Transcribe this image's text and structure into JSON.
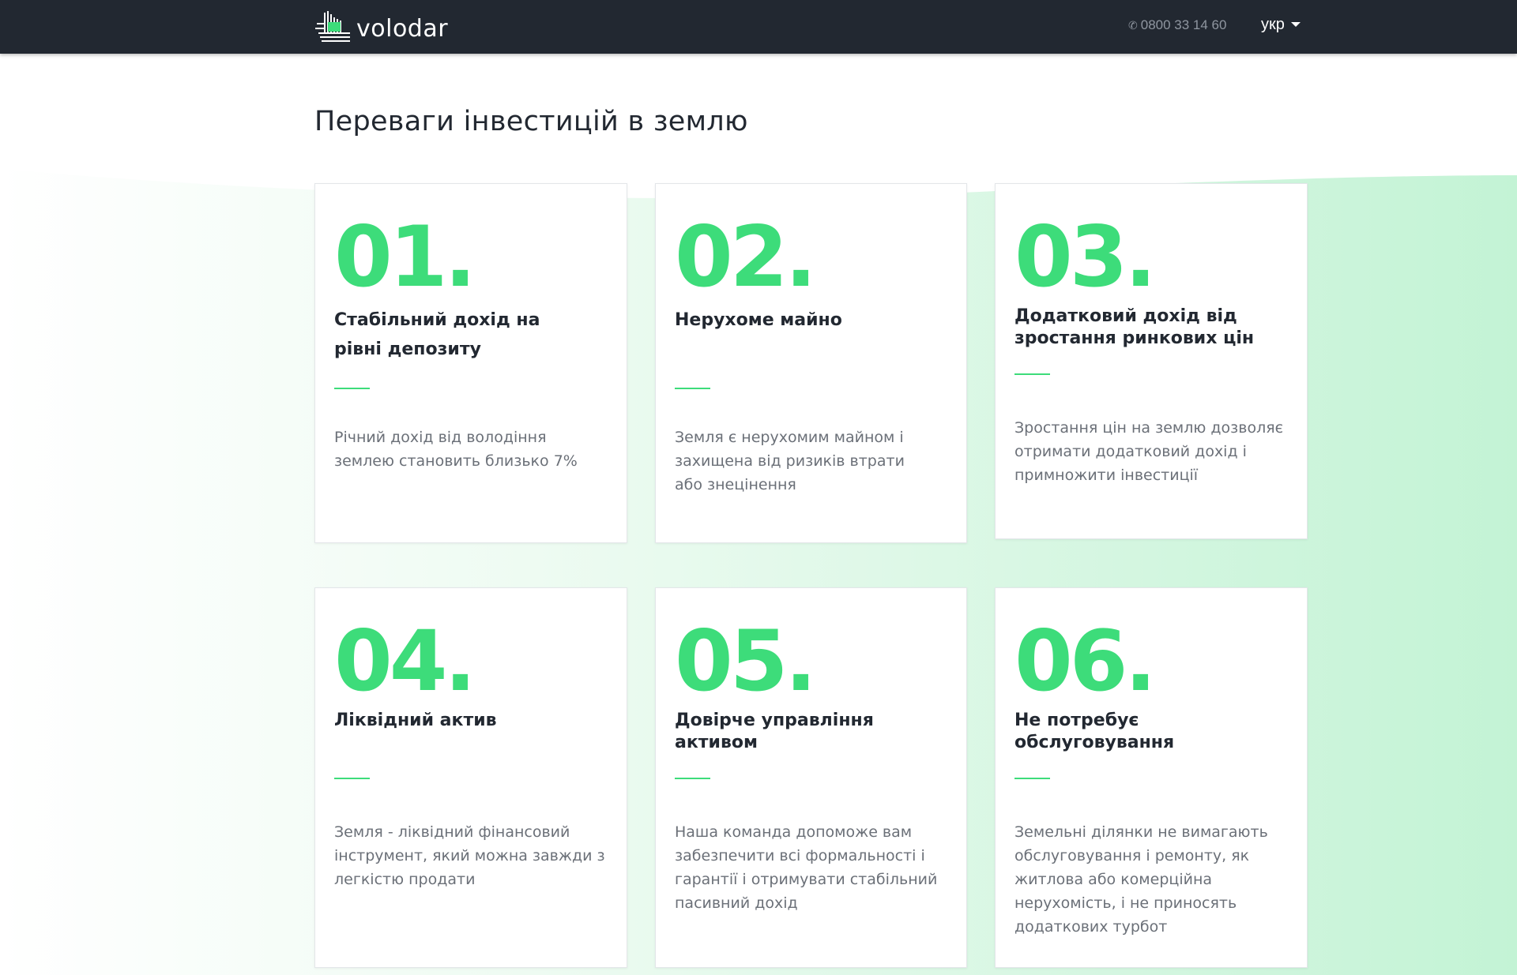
{
  "header": {
    "logo_text": "volodar",
    "phone": "0800 33 14 60",
    "phone_icon": "phone-icon",
    "language": "укр"
  },
  "section": {
    "title": "Переваги інвестицій в землю"
  },
  "colors": {
    "accent": "#3ddc7a",
    "navbar": "#222831",
    "text_dark": "#222831",
    "text_muted": "#6b7078"
  },
  "cards": [
    {
      "num": "01.",
      "title": "Стабільний дохід на рівні депозиту",
      "text": "Річний дохід від володіння землею становить близько 7%"
    },
    {
      "num": "02.",
      "title": "Нерухоме майно",
      "text": "Земля є нерухомим майном і захищена від ризиків втрати або знецінення"
    },
    {
      "num": "03.",
      "title": "Додатковий дохід від зростання ринкових цін",
      "text": "Зростання цін на землю дозволяє отримати додатковий дохід і примножити інвестиції"
    },
    {
      "num": "04.",
      "title": "Ліквідний актив",
      "text": "Земля - ліквідний фінансовий інструмент, який можна завжди з легкістю продати"
    },
    {
      "num": "05.",
      "title": "Довірче управління активом",
      "text": "Наша команда допоможе вам забезпечити всі формальності і гарантії і отримувати стабільний пасивний дохід"
    },
    {
      "num": "06.",
      "title": "Не потребує обслуговування",
      "text": "Земельні ділянки не вимагають обслуговування і ремонту, як житлова або комерційна нерухомість, і не приносять додаткових турбот"
    }
  ]
}
